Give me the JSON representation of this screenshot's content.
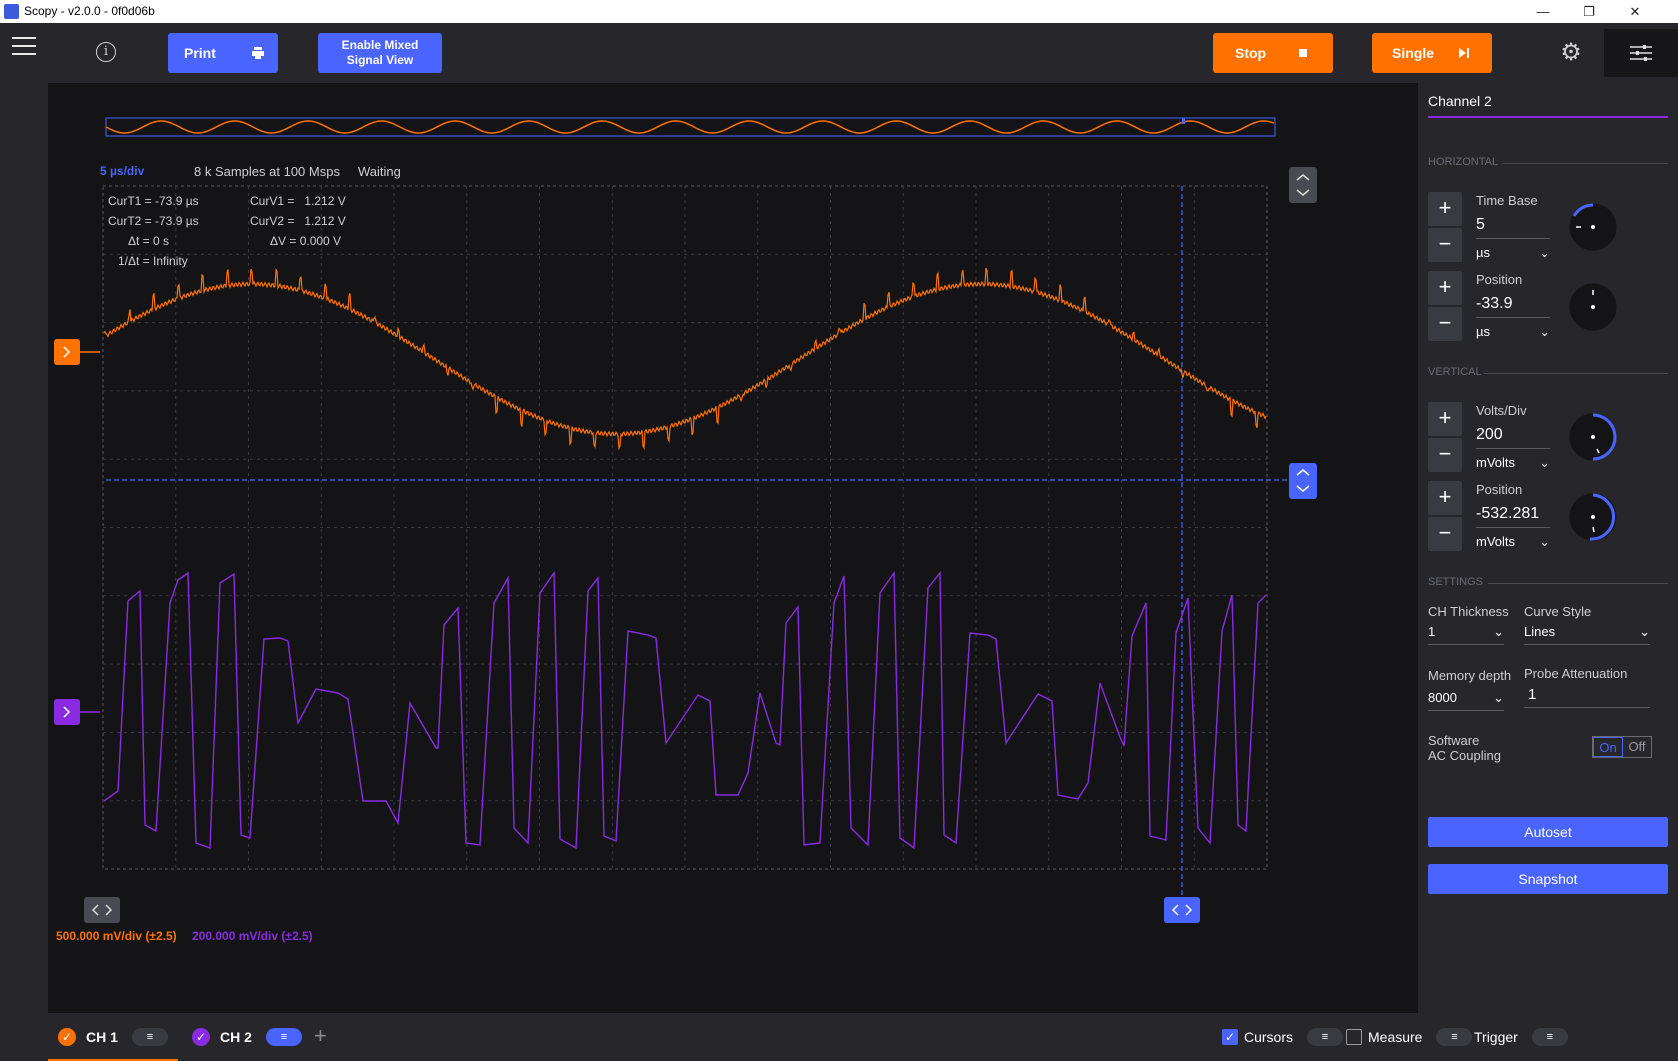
{
  "window": {
    "title": "Scopy - v2.0.0 - 0f0d06b",
    "minimize": "—",
    "restore": "❐",
    "close": "✕"
  },
  "toolbar": {
    "print_label": "Print",
    "mixed_label_line1": "Enable Mixed",
    "mixed_label_line2": "Signal View",
    "stop_label": "Stop",
    "single_label": "Single"
  },
  "status": {
    "timebase": "5 µs/div",
    "samples": "8 k Samples at 100 Msps",
    "state": "Waiting"
  },
  "cursors": {
    "curT1": "CurT1 = -73.9 µs",
    "curT2": "CurT2 = -73.9 µs",
    "dt": "Δt = 0 s",
    "inv_dt": "1/Δt = Infinity",
    "curV1": "CurV1 =   1.212 V",
    "curV2": "CurV2 =   1.212 V",
    "dV": "ΔV = 0.000 V"
  },
  "scales": {
    "ch1": "500.000 mV/div (±2.5)",
    "ch2": "200.000 mV/div (±2.5)"
  },
  "colors": {
    "ch1": "#ff7200",
    "ch2": "#8a2be2",
    "accent": "#4a64ff",
    "panel": "#26262b",
    "plot": "#141417"
  },
  "panel": {
    "title": "Channel 2",
    "horizontal": "HORIZONTAL",
    "vertical": "VERTICAL",
    "settings": "SETTINGS",
    "timebase": {
      "label": "Time Base",
      "value": "5",
      "unit": "µs"
    },
    "hposition": {
      "label": "Position",
      "value": "-33.9",
      "unit": "µs"
    },
    "voltsdiv": {
      "label": "Volts/Div",
      "value": "200",
      "unit": "mVolts"
    },
    "vposition": {
      "label": "Position",
      "value": "-532.281",
      "unit": "mVolts"
    },
    "thickness": {
      "label": "CH Thickness",
      "value": "1"
    },
    "curve": {
      "label": "Curve Style",
      "value": "Lines"
    },
    "memory": {
      "label": "Memory depth",
      "value": "8000"
    },
    "probe": {
      "label": "Probe Attenuation",
      "value": "1"
    },
    "ac_label_line1": "Software",
    "ac_label_line2": "AC Coupling",
    "ac_on": "On",
    "ac_off": "Off",
    "autoset": "Autoset",
    "snapshot": "Snapshot"
  },
  "bottom": {
    "ch1": "CH 1",
    "ch2": "CH 2",
    "add": "+",
    "cursors": "Cursors",
    "measure": "Measure",
    "trigger": "Trigger"
  }
}
